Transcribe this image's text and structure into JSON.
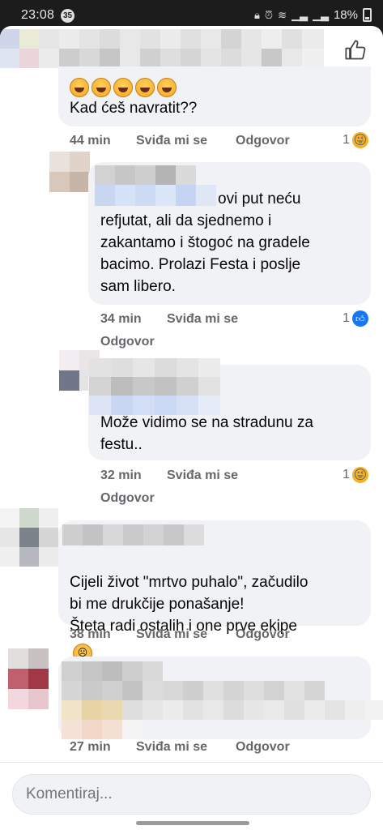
{
  "status_bar": {
    "time": "23:08",
    "notification_count": "35",
    "battery": "18%"
  },
  "comments": [
    {
      "text": "Kad ćeš navratit??",
      "time": "44 min",
      "like_label": "Sviđa mi se",
      "reply_label": "Odgovor",
      "reaction_count": "1",
      "reaction_icon": "haha-emoji-icon",
      "emoji_row": [
        "laughing-emoji-icon",
        "rofl-emoji-icon",
        "laughing-emoji-icon",
        "rofl-emoji-icon",
        "laughing-emoji-icon"
      ]
    },
    {
      "text": "ovi put neću\nrefjutat, ali da sjednemo i\nzakantamo i štogoć na gradele\nbacimo.  Prolazi Festa i poslje\nsam libero.",
      "time": "34 min",
      "like_label": "Sviđa mi se",
      "reply_label": "Odgovor",
      "reaction_count": "1",
      "reaction_icon": "like-icon"
    },
    {
      "text": "Može vidimo se na stradunu za\nfestu..",
      "time": "32 min",
      "like_label": "Sviđa mi se",
      "reply_label": "Odgovor",
      "reaction_count": "1",
      "reaction_icon": "haha-emoji-icon"
    },
    {
      "text": "Cijeli život \"mrtvo puhalo\", začudilo\nbi me drukčije ponašanje!\nŠteta radi ostalih i one prve ekipe",
      "time": "38 min",
      "like_label": "Sviđa mi se",
      "reply_label": "Odgovor",
      "trailing_emoji": "sad-face-emoji-icon"
    },
    {
      "time": "27 min",
      "like_label": "Sviđa mi se",
      "reply_label": "Odgovor"
    }
  ],
  "composer": {
    "placeholder": "Komentiraj..."
  },
  "colors": {
    "bubble": "#f0f2f5",
    "meta_text": "#65676b",
    "like_blue": "#1877f2",
    "haha_yellow": "#f7b125"
  }
}
